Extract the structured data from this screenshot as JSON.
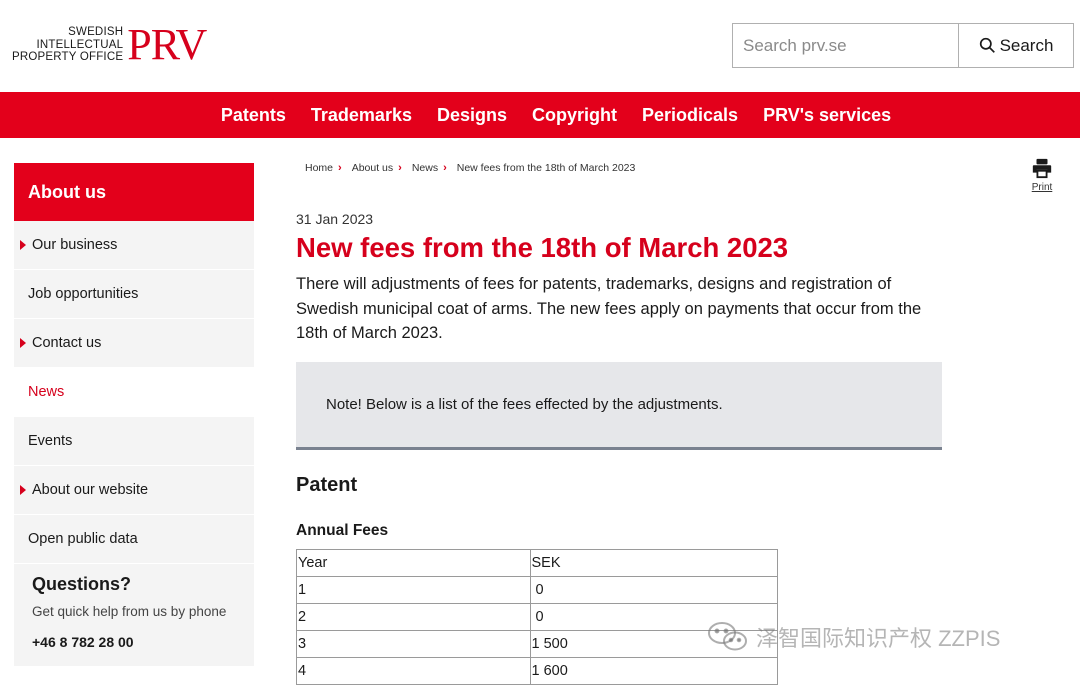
{
  "header": {
    "logo_lines": [
      "SWEDISH",
      "INTELLECTUAL",
      "PROPERTY OFFICE"
    ],
    "logo_mark": "PRV",
    "search_placeholder": "Search prv.se",
    "search_button": "Search",
    "search_icon": "search-icon"
  },
  "nav": {
    "items": [
      "Patents",
      "Trademarks",
      "Designs",
      "Copyright",
      "Periodicals",
      "PRV's services"
    ]
  },
  "sidebar": {
    "heading": "About us",
    "items": [
      {
        "label": "Our business",
        "arrow": true,
        "active": false
      },
      {
        "label": "Job opportunities",
        "arrow": false,
        "active": false
      },
      {
        "label": "Contact us",
        "arrow": true,
        "active": false
      },
      {
        "label": "News",
        "arrow": false,
        "active": true
      },
      {
        "label": "Events",
        "arrow": false,
        "active": false
      },
      {
        "label": "About our website",
        "arrow": true,
        "active": false
      },
      {
        "label": "Open public data",
        "arrow": false,
        "active": false
      }
    ],
    "questions": {
      "title": "Questions?",
      "subtitle": "Get quick help from us by phone",
      "phone": "+46 8 782 28 00"
    }
  },
  "breadcrumb": {
    "items": [
      "Home",
      "About us",
      "News"
    ],
    "current": "New fees from the 18th of March 2023"
  },
  "print": {
    "label": "Print",
    "icon": "printer-icon"
  },
  "article": {
    "date": "31 Jan 2023",
    "title": "New fees from the 18th of March 2023",
    "lead": "There will adjustments of fees for patents, trademarks, designs and registration of Swedish municipal coat of arms. The new fees apply on payments that occur from the 18th of March 2023.",
    "note": "Note! Below is a list of the fees effected by the adjustments.",
    "section_heading": "Patent",
    "subheading": "Annual Fees",
    "table": {
      "headers": [
        "Year",
        "SEK"
      ],
      "rows": [
        [
          "1",
          " 0"
        ],
        [
          "2",
          " 0"
        ],
        [
          "3",
          "1 500"
        ],
        [
          "4",
          "1 600"
        ]
      ]
    }
  },
  "watermark": {
    "text": "泽智国际知识产权 ZZPIS",
    "icon": "wechat-icon"
  },
  "colors": {
    "brand_red": "#e3001b",
    "note_bg": "#e6e7ea",
    "sidebar_bg": "#f4f4f4"
  }
}
